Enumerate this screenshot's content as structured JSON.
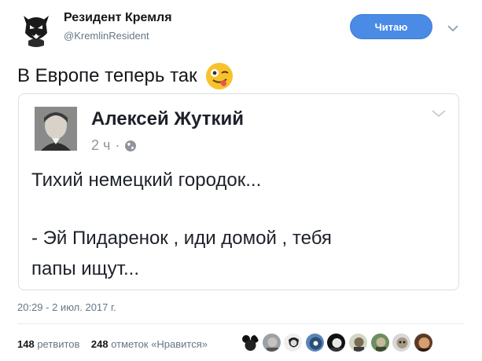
{
  "author": {
    "name": "Резидент Кремля",
    "handle": "@KremlinResident",
    "follow_label": "Читаю"
  },
  "tweet": {
    "text": "В Европе теперь так",
    "emoji": "winking-face-with-tongue"
  },
  "quote": {
    "name": "Алексей Жуткий",
    "time": "2 ч",
    "separator": "·",
    "lines": [
      "Тихий немецкий городок...",
      "- Эй Пидаренок , иди домой , тебя",
      "папы ищут..."
    ]
  },
  "timestamp": "20:29 - 2 июл. 2017 г.",
  "stats": {
    "retweets_count": "148",
    "retweets_label": "ретвитов",
    "likes_count": "248",
    "likes_label": "отметок «Нравится»"
  },
  "colors": {
    "follow_button": "#4a8be6",
    "secondary_text": "#657786",
    "border": "#d9dfe3"
  }
}
